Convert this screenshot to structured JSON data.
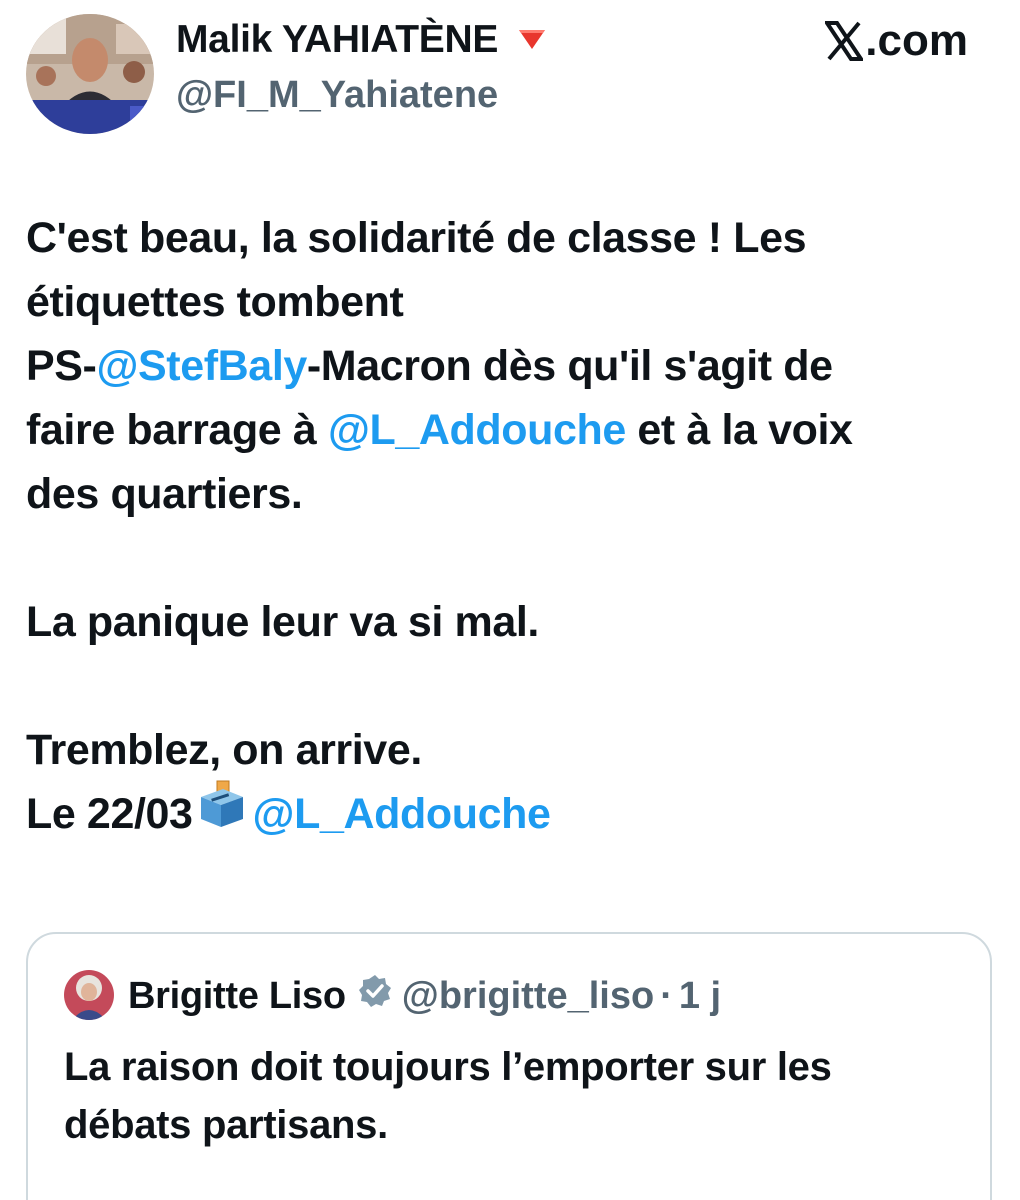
{
  "author": {
    "display_name": "Malik YAHIATÈNE",
    "handle": "@FI_M_Yahiatene",
    "badge_icon": "red-triangle-down-icon"
  },
  "site": {
    "logo_icon": "x-logo-icon",
    "domain": ".com"
  },
  "tweet": {
    "line1": "C'est beau, la solidarité de classe ! Les",
    "line2": "étiquettes tombent",
    "line3_prefix": "PS-",
    "line3_mention": "@StefBaly",
    "line3_suffix": "-Macron dès qu'il s'agit de",
    "line4_prefix": "faire barrage à ",
    "line4_mention": "@L_Addouche",
    "line4_suffix": " et à la voix",
    "line5": "des quartiers.",
    "paragraph2": "La panique leur va si mal.",
    "line6": "Tremblez, on arrive.",
    "line7_prefix": "Le 22/03",
    "line7_icon": "ballot-box-icon",
    "line7_mention": "@L_Addouche",
    "mention_color": "#1d9bf0"
  },
  "quoted_tweet": {
    "display_name": "Brigitte Liso",
    "verified_icon": "verified-badge-icon",
    "handle": "@brigitte_liso",
    "separator": "·",
    "time": "1 j",
    "text_line1": "La raison doit toujours l’emporter sur les",
    "text_line2": "débats partisans."
  }
}
